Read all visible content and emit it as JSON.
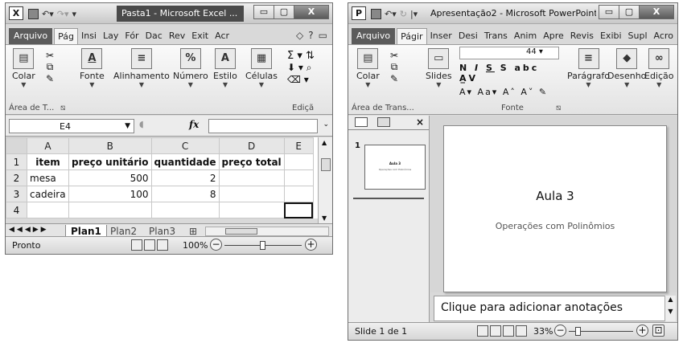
{
  "excel": {
    "app_icon": "X",
    "title": "Pasta1 - Microsoft Excel ...",
    "tabs": [
      "Arquivo",
      "Pág",
      "Insi",
      "Lay",
      "Fór",
      "Dac",
      "Rev",
      "Exit",
      "Acr"
    ],
    "ribbon": {
      "paste": "Colar",
      "font": "Fonte",
      "alignment": "Alinhamento",
      "number": "Número",
      "style": "Estilo",
      "cells": "Células",
      "clipboard_group": "Área de T...",
      "edit_group": "Ediçã"
    },
    "name_box": "E4",
    "fx": "fx",
    "columns": [
      "A",
      "B",
      "C",
      "D",
      "E"
    ],
    "rows": [
      {
        "num": "1",
        "cells": [
          "item",
          "preço unitário",
          "quantidade",
          "preço total",
          ""
        ]
      },
      {
        "num": "2",
        "cells": [
          "mesa",
          "500",
          "2",
          "",
          ""
        ]
      },
      {
        "num": "3",
        "cells": [
          "cadeira",
          "100",
          "8",
          "",
          ""
        ]
      },
      {
        "num": "4",
        "cells": [
          "",
          "",
          "",
          "",
          ""
        ]
      }
    ],
    "sheets": [
      "Plan1",
      "Plan2",
      "Plan3"
    ],
    "status": "Pronto",
    "zoom": "100%"
  },
  "ppt": {
    "app_icon": "P",
    "title": "Apresentação2 - Microsoft PowerPoint ...",
    "tabs": [
      "Arquivo",
      "Págir",
      "Inser",
      "Desi",
      "Trans",
      "Anim",
      "Apre",
      "Revis",
      "Exibi",
      "Supl",
      "Acro"
    ],
    "ribbon": {
      "paste": "Colar",
      "slides": "Slides",
      "font_size": "44",
      "paragraph": "Parágrafo",
      "drawing": "Desenho",
      "edit": "Edição",
      "clipboard_group": "Área de Trans...",
      "font_group": "Fonte"
    },
    "thumb_number": "1",
    "slide_title": "Aula 3",
    "slide_subtitle": "Operações com Polinômios",
    "notes_placeholder": "Clique para adicionar anotações",
    "status": "Slide 1 de 1",
    "zoom": "33%"
  }
}
